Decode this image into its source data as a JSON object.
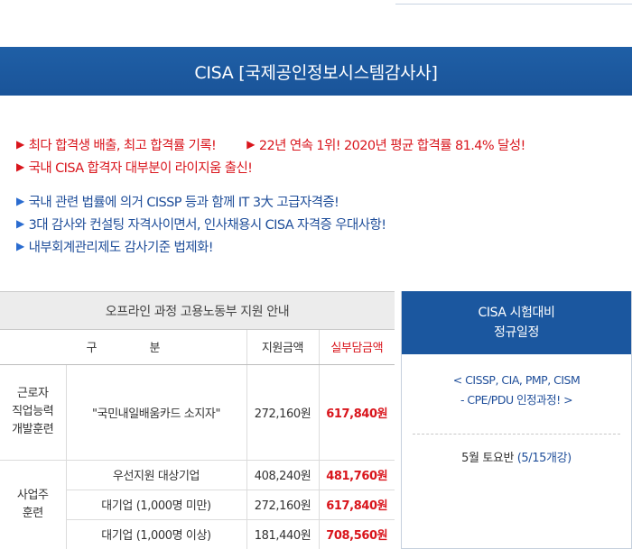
{
  "banner": {
    "title": "CISA  [국제공인정보시스템감사사]"
  },
  "highlights_red": [
    [
      "최다 합격생 배출, 최고 합격률 기록!",
      "22년 연속 1위! 2020년 평균 합격률 81.4% 달성!"
    ],
    [
      "국내 CISA 합격자 대부분이 라이지움 출신!"
    ]
  ],
  "highlights_blue": [
    "국내 관련 법률에 의거 CISSP 등과 함께 IT 3大 고급자격증!",
    "3대 감사와 컨설팅 자격사이면서, 인사채용시 CISA 자격증 우대사항!",
    "내부회계관리제도 감사기준 법제화!"
  ],
  "arrow_glyph": "▶",
  "table": {
    "title": "오프라인 과정 고용노동부 지원 안내",
    "headers": {
      "gu": "구",
      "bun": "분",
      "support": "지원금액",
      "self_pay": "실부담금액"
    },
    "rows": [
      {
        "category": [
          "근로자",
          "직업능력",
          "개발훈련"
        ],
        "name": "\"국민내일배움카드 소지자\"",
        "support": "272,160원",
        "self_pay": "617,840원"
      },
      {
        "category": [
          "사업주",
          "훈련"
        ],
        "name": "우선지원 대상기업",
        "support": "408,240원",
        "self_pay": "481,760원"
      },
      {
        "name": "대기업 (1,000명 미만)",
        "support": "272,160원",
        "self_pay": "617,840원"
      },
      {
        "name": "대기업 (1,000명 이상)",
        "support": "181,440원",
        "self_pay": "708,560원"
      }
    ]
  },
  "side": {
    "title_line1": "CISA 시험대비",
    "title_line2": "정규일정",
    "note_line1": "< CISSP, CIA, PMP, CISM",
    "note_line2": "- CPE/PDU 인정과정! >",
    "schedule_prefix": "5월 토요반",
    "schedule_detail": "(5/15개강)"
  },
  "colors": {
    "brand_blue": "#1b579f",
    "accent_red": "#d9151c",
    "text_blue": "#1f4e9a"
  }
}
